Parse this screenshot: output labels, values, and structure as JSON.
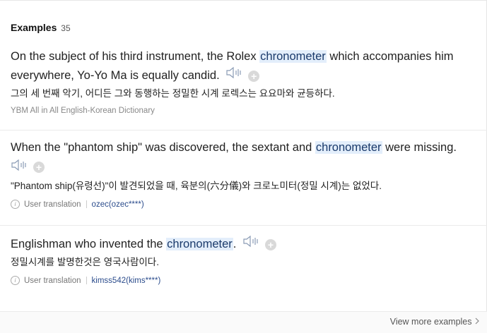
{
  "section": {
    "title": "Examples",
    "count": "35"
  },
  "examples": [
    {
      "en_before": "On the subject of his third instrument, the Rolex ",
      "en_highlight": "chronometer",
      "en_after": " which accompanies him everywhere, Yo-Yo Ma is equally candid.",
      "ko": "그의 세 번째 악기, 어디든 그와 동행하는 정밀한 시계 로렉스는 요요마와 균등하다.",
      "source": "YBM All in All English-Korean Dictionary"
    },
    {
      "en_before": "When the \"phantom ship\" was discovered, the sextant and ",
      "en_highlight": "chronometer",
      "en_after": " were missing.",
      "ko": "\"Phantom ship(유령선)\"이 발견되었을 때, 육분의(六分儀)와 크로노미터(정밀 시계)는 없었다.",
      "meta_label": "User translation",
      "user": "ozec(ozec****)"
    },
    {
      "en_before": "Englishman who invented the ",
      "en_highlight": "chronometer",
      "en_after": ".",
      "ko": "정밀시계를 발명한것은 영국사람이다.",
      "meta_label": "User translation",
      "user": "kimss542(kims****)"
    }
  ],
  "footer": {
    "more_label": "View more examples"
  },
  "icons": {
    "speaker": "speaker-icon",
    "add": "plus-icon",
    "info": "info-icon",
    "chevron": "chevron-right-icon"
  }
}
